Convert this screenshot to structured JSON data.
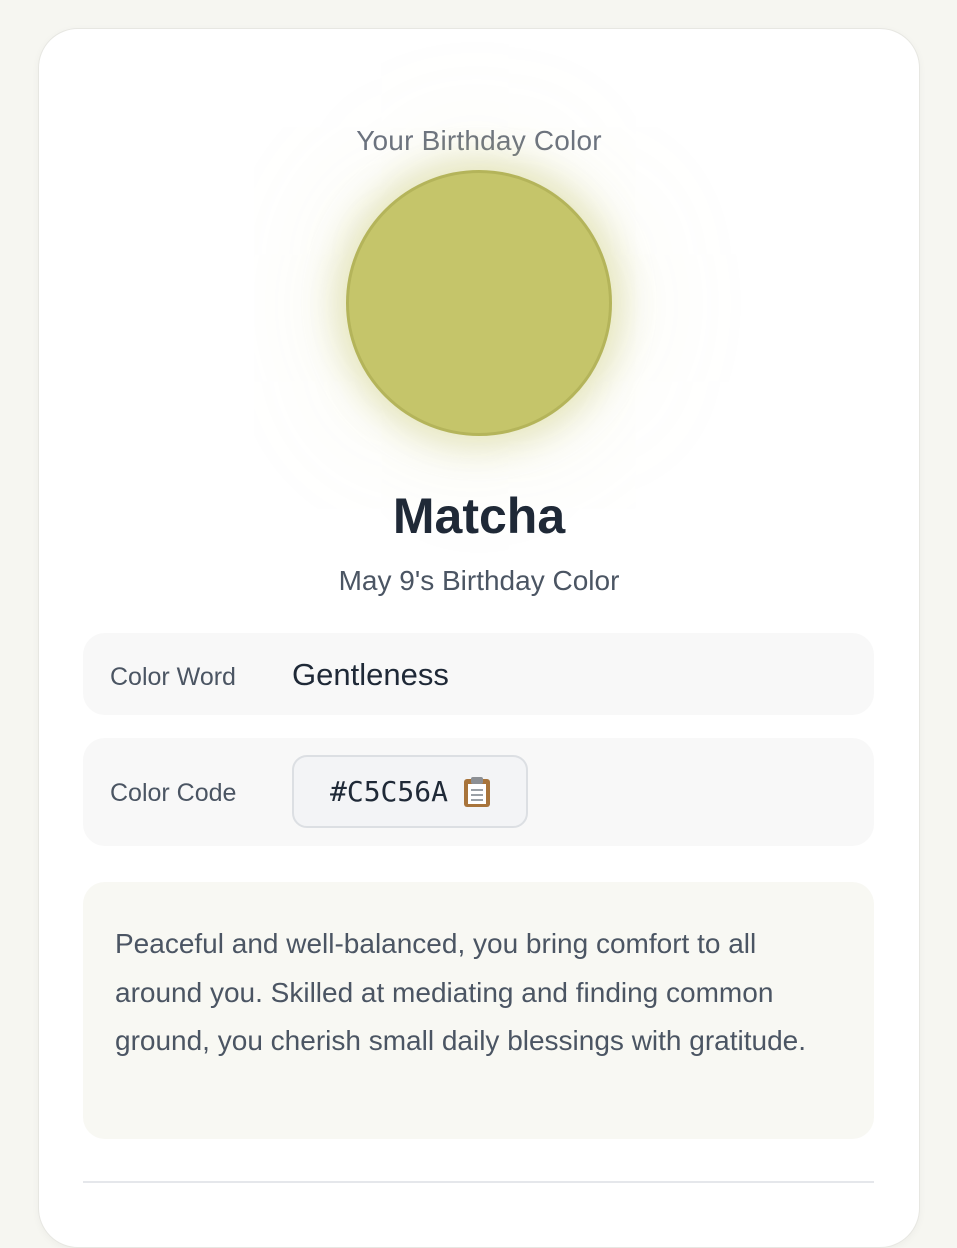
{
  "card": {
    "eyebrow": "Your Birthday Color",
    "swatch_color": "#C5C56A",
    "color_name": "Matcha",
    "subtitle": "May 9's Birthday Color"
  },
  "details": {
    "word_label": "Color Word",
    "word_value": "Gentleness",
    "code_label": "Color Code",
    "code_value": "#C5C56A",
    "copy_icon": "clipboard-icon"
  },
  "description": "Peaceful and well-balanced, you bring comfort to all around you. Skilled at mediating and finding common ground, you cherish small daily blessings with gratitude."
}
